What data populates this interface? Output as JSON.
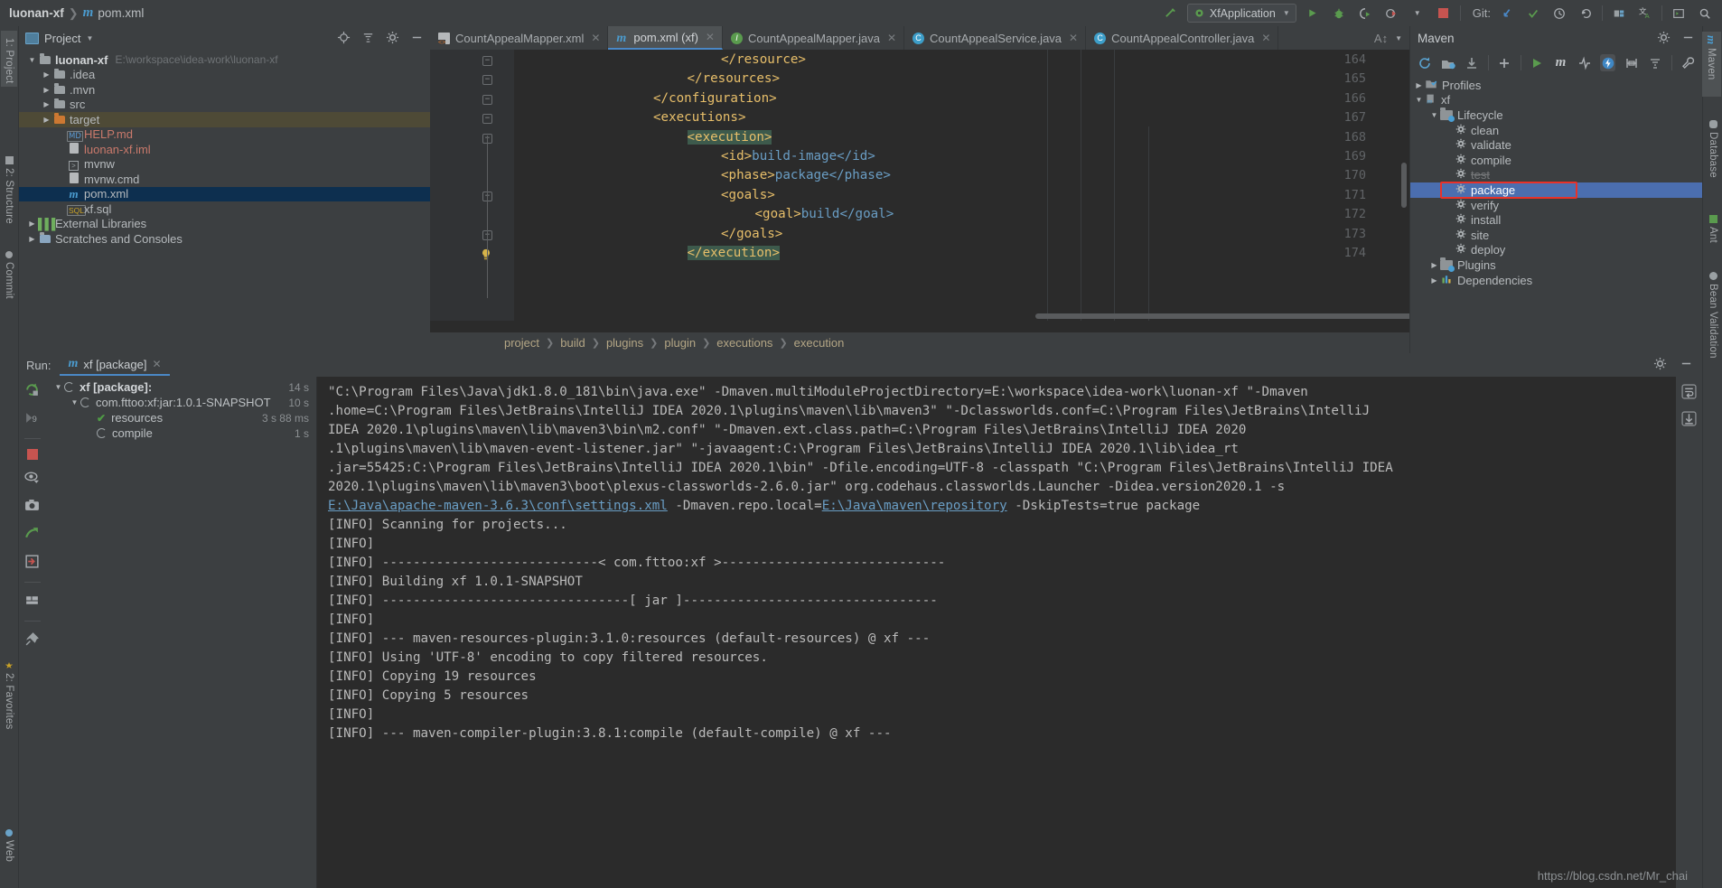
{
  "topbar": {
    "project": "luonan-xf",
    "separator": "❯",
    "file": "pom.xml",
    "run_config": "XfApplication",
    "git_label": "Git:"
  },
  "project_panel": {
    "title": "Project",
    "tree": [
      {
        "label": "luonan-xf",
        "path": "E:\\workspace\\idea-work\\luonan-xf",
        "kind": "module",
        "depth": 0,
        "arrow": "▼",
        "state": "bold"
      },
      {
        "label": ".idea",
        "path": "",
        "kind": "folder",
        "depth": 1,
        "arrow": "▶",
        "state": ""
      },
      {
        "label": ".mvn",
        "path": "",
        "kind": "folder",
        "depth": 1,
        "arrow": "▶",
        "state": ""
      },
      {
        "label": "src",
        "path": "",
        "kind": "folder",
        "depth": 1,
        "arrow": "▶",
        "state": ""
      },
      {
        "label": "target",
        "path": "",
        "kind": "folder-orange",
        "depth": 1,
        "arrow": "▶",
        "state": "target"
      },
      {
        "label": "HELP.md",
        "path": "",
        "kind": "md",
        "depth": 2,
        "arrow": "",
        "state": "red"
      },
      {
        "label": "luonan-xf.iml",
        "path": "",
        "kind": "iml",
        "depth": 2,
        "arrow": "",
        "state": "red"
      },
      {
        "label": "mvnw",
        "path": "",
        "kind": "script",
        "depth": 2,
        "arrow": "",
        "state": ""
      },
      {
        "label": "mvnw.cmd",
        "path": "",
        "kind": "cmd",
        "depth": 2,
        "arrow": "",
        "state": ""
      },
      {
        "label": "pom.xml",
        "path": "",
        "kind": "maven",
        "depth": 2,
        "arrow": "",
        "state": "selected"
      },
      {
        "label": "xf.sql",
        "path": "",
        "kind": "sql",
        "depth": 2,
        "arrow": "",
        "state": ""
      },
      {
        "label": "External Libraries",
        "path": "",
        "kind": "libs",
        "depth": 0,
        "arrow": "▶",
        "state": ""
      },
      {
        "label": "Scratches and Consoles",
        "path": "",
        "kind": "scratch",
        "depth": 0,
        "arrow": "▶",
        "state": ""
      }
    ]
  },
  "left_tool_tabs": [
    {
      "label": "1: Project",
      "selected": true
    },
    {
      "label": "2: Structure",
      "selected": false
    },
    {
      "label": "Commit",
      "selected": false
    },
    {
      "label": "2: Favorites",
      "selected": false
    },
    {
      "label": "Web",
      "selected": false
    }
  ],
  "right_tool_tabs": [
    {
      "label": "Maven",
      "selected": true
    },
    {
      "label": "Database",
      "selected": false
    },
    {
      "label": "Ant",
      "selected": false
    },
    {
      "label": "Bean Validation",
      "selected": false
    }
  ],
  "editor": {
    "tabs": [
      {
        "label": "CountAppealMapper.xml",
        "icon": "xml-file-icon",
        "active": false
      },
      {
        "label": "pom.xml (xf)",
        "icon": "maven-file-icon",
        "active": true
      },
      {
        "label": "CountAppealMapper.java",
        "icon": "interface-icon",
        "active": false
      },
      {
        "label": "CountAppealService.java",
        "icon": "class-icon",
        "active": false
      },
      {
        "label": "CountAppealController.java",
        "icon": "class-icon",
        "active": false
      }
    ],
    "lines": [
      {
        "num": "164",
        "indent": 6,
        "text": "</resource>",
        "fold": "-"
      },
      {
        "num": "165",
        "indent": 5,
        "text": "</resources>",
        "fold": "-"
      },
      {
        "num": "166",
        "indent": 4,
        "text": "</configuration>",
        "fold": "-"
      },
      {
        "num": "167",
        "indent": 4,
        "text": "<executions>",
        "fold": "-"
      },
      {
        "num": "168",
        "indent": 5,
        "text": "<execution>",
        "fold": "-",
        "highlight": true
      },
      {
        "num": "169",
        "indent": 6,
        "text": "<id>build-image</id>",
        "fold": ""
      },
      {
        "num": "170",
        "indent": 6,
        "text": "<phase>package</phase>",
        "fold": ""
      },
      {
        "num": "171",
        "indent": 6,
        "text": "<goals>",
        "fold": "-"
      },
      {
        "num": "172",
        "indent": 7,
        "text": "<goal>build</goal>",
        "fold": ""
      },
      {
        "num": "173",
        "indent": 6,
        "text": "</goals>",
        "fold": "-"
      },
      {
        "num": "174",
        "indent": 5,
        "text": "</execution>",
        "fold": "",
        "bulb": true,
        "highlight": true
      }
    ],
    "breadcrumbs": [
      "project",
      "build",
      "plugins",
      "plugin",
      "executions",
      "execution"
    ]
  },
  "maven_panel": {
    "title": "Maven",
    "tree": [
      {
        "label": "Profiles",
        "depth": 0,
        "arrow": "▶",
        "icon": "profiles-icon",
        "selected": false,
        "strike": false
      },
      {
        "label": "xf",
        "depth": 0,
        "arrow": "▼",
        "icon": "maven-module-icon",
        "selected": false,
        "strike": false
      },
      {
        "label": "Lifecycle",
        "depth": 1,
        "arrow": "▼",
        "icon": "lifecycle-icon",
        "selected": false,
        "strike": false
      },
      {
        "label": "clean",
        "depth": 2,
        "arrow": "",
        "icon": "goal-icon",
        "selected": false,
        "strike": false
      },
      {
        "label": "validate",
        "depth": 2,
        "arrow": "",
        "icon": "goal-icon",
        "selected": false,
        "strike": false
      },
      {
        "label": "compile",
        "depth": 2,
        "arrow": "",
        "icon": "goal-icon",
        "selected": false,
        "strike": false
      },
      {
        "label": "test",
        "depth": 2,
        "arrow": "",
        "icon": "goal-icon",
        "selected": false,
        "strike": true
      },
      {
        "label": "package",
        "depth": 2,
        "arrow": "",
        "icon": "goal-icon",
        "selected": true,
        "strike": false
      },
      {
        "label": "verify",
        "depth": 2,
        "arrow": "",
        "icon": "goal-icon",
        "selected": false,
        "strike": false
      },
      {
        "label": "install",
        "depth": 2,
        "arrow": "",
        "icon": "goal-icon",
        "selected": false,
        "strike": false
      },
      {
        "label": "site",
        "depth": 2,
        "arrow": "",
        "icon": "goal-icon",
        "selected": false,
        "strike": false
      },
      {
        "label": "deploy",
        "depth": 2,
        "arrow": "",
        "icon": "goal-icon",
        "selected": false,
        "strike": false
      },
      {
        "label": "Plugins",
        "depth": 1,
        "arrow": "▶",
        "icon": "plugins-icon",
        "selected": false,
        "strike": false
      },
      {
        "label": "Dependencies",
        "depth": 1,
        "arrow": "▶",
        "icon": "dependencies-icon",
        "selected": false,
        "strike": false
      }
    ]
  },
  "run_panel": {
    "run_label": "Run:",
    "tab_label": "xf [package]",
    "tree": [
      {
        "label": "xf [package]:",
        "depth": 0,
        "arrow": "▼",
        "status": "running",
        "time": "14 s",
        "bold": true
      },
      {
        "label": "com.fttoo:xf:jar:1.0.1-SNAPSHOT",
        "depth": 1,
        "arrow": "▼",
        "status": "running",
        "time": "10 s",
        "bold": false
      },
      {
        "label": "resources",
        "depth": 2,
        "arrow": "",
        "status": "done",
        "time": "3 s 88 ms",
        "bold": false
      },
      {
        "label": "compile",
        "depth": 2,
        "arrow": "",
        "status": "running",
        "time": "1 s",
        "bold": false
      }
    ],
    "console": {
      "pre_link": "\"C:\\Program Files\\Java\\jdk1.8.0_181\\bin\\java.exe\" -Dmaven.multiModuleProjectDirectory=E:\\workspace\\idea-work\\luonan-xf \"-Dmaven\n.home=C:\\Program Files\\JetBrains\\IntelliJ IDEA 2020.1\\plugins\\maven\\lib\\maven3\" \"-Dclassworlds.conf=C:\\Program Files\\JetBrains\\IntelliJ\nIDEA 2020.1\\plugins\\maven\\lib\\maven3\\bin\\m2.conf\" \"-Dmaven.ext.class.path=C:\\Program Files\\JetBrains\\IntelliJ IDEA 2020\n.1\\plugins\\maven\\lib\\maven-event-listener.jar\" \"-javaagent:C:\\Program Files\\JetBrains\\IntelliJ IDEA 2020.1\\lib\\idea_rt\n.jar=55425:C:\\Program Files\\JetBrains\\IntelliJ IDEA 2020.1\\bin\" -Dfile.encoding=UTF-8 -classpath \"C:\\Program Files\\JetBrains\\IntelliJ IDEA\n2020.1\\plugins\\maven\\lib\\maven3\\boot\\plexus-classworlds-2.6.0.jar\" org.codehaus.classworlds.Launcher -Didea.version2020.1 -s\n",
      "link1": "E:\\Java\\apache-maven-3.6.3\\conf\\settings.xml",
      "mid": " -Dmaven.repo.local=",
      "link2": "E:\\Java\\maven\\repository",
      "post": " -DskipTests=true package",
      "log_lines": [
        "[INFO] Scanning for projects...",
        "[INFO] ",
        "[INFO] ----------------------------< com.fttoo:xf >-----------------------------",
        "[INFO] Building xf 1.0.1-SNAPSHOT",
        "[INFO] --------------------------------[ jar ]---------------------------------",
        "[INFO] ",
        "[INFO] --- maven-resources-plugin:3.1.0:resources (default-resources) @ xf ---",
        "[INFO] Using 'UTF-8' encoding to copy filtered resources.",
        "[INFO] Copying 19 resources",
        "[INFO] Copying 5 resources",
        "[INFO] ",
        "[INFO] --- maven-compiler-plugin:3.8.1:compile (default-compile) @ xf ---"
      ]
    }
  },
  "watermark": "https://blog.csdn.net/Mr_chai",
  "colors": {
    "accent_blue": "#4b6eaf",
    "selection_red": "#e8322a",
    "xml_tag": "#e8bf6a",
    "xml_text": "#6a9ec5",
    "editor_bg": "#2b2b2b",
    "panel_bg": "#3c3f41"
  }
}
